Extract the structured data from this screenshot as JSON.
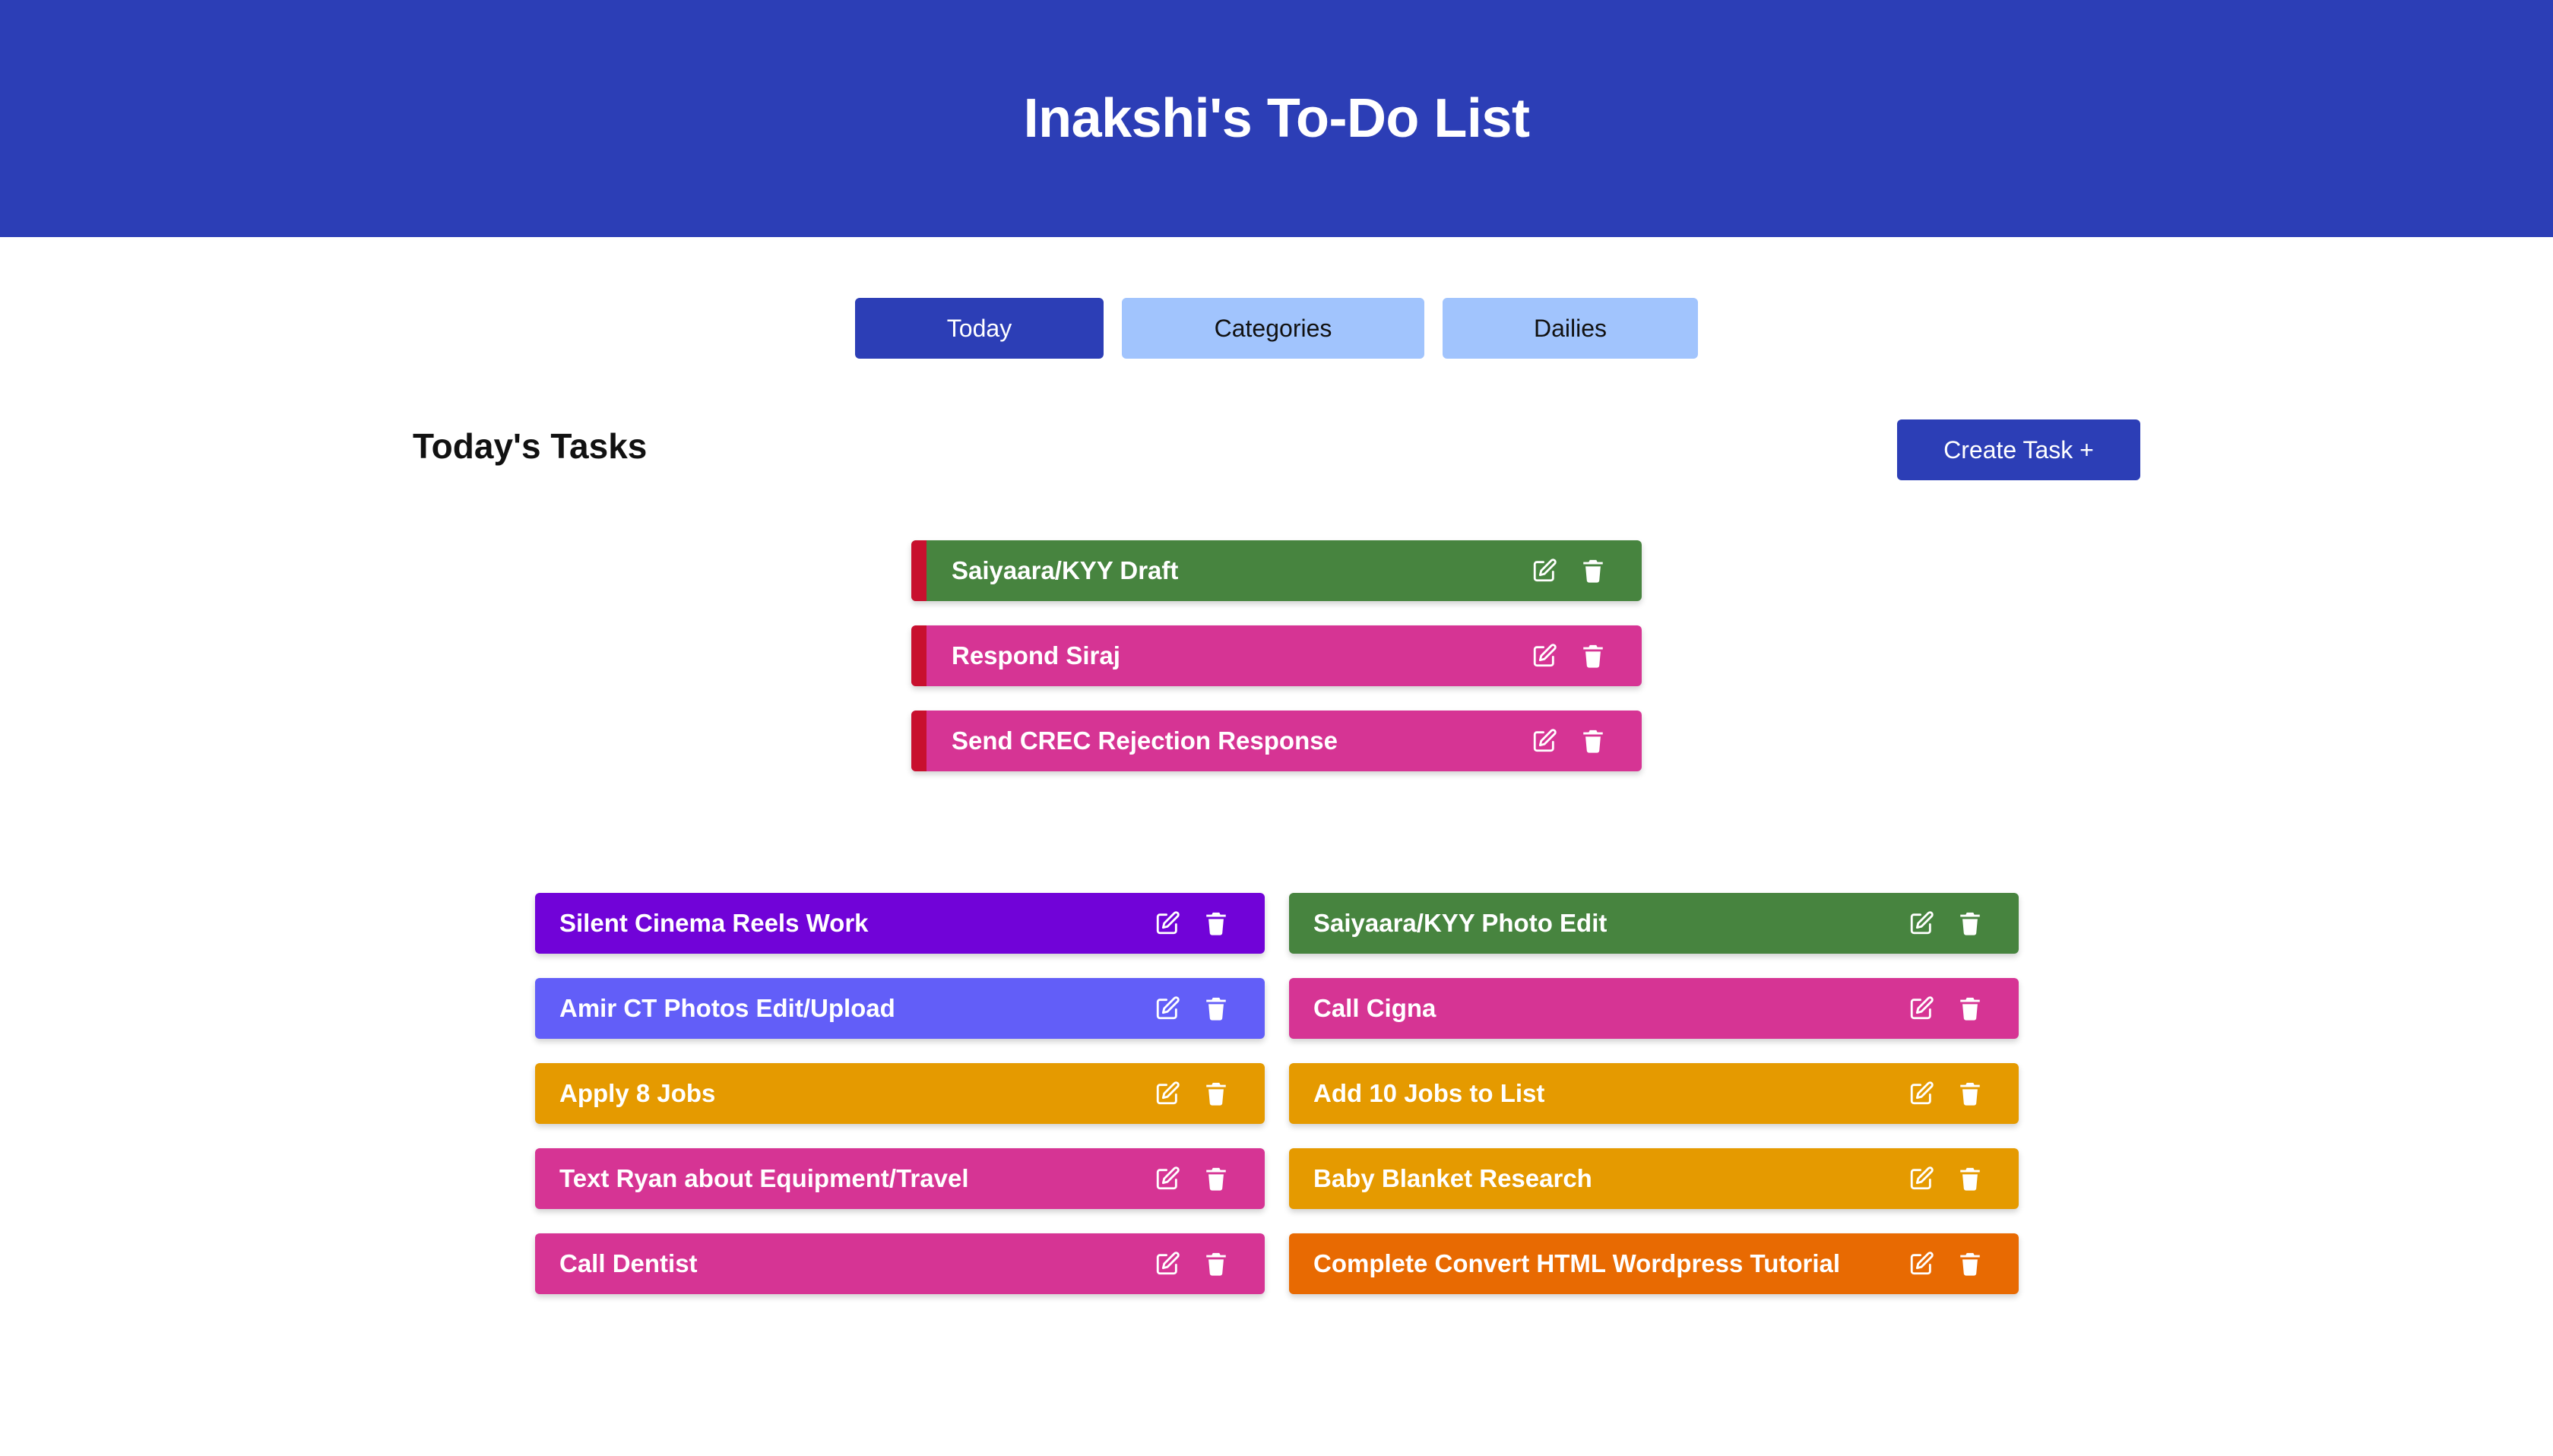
{
  "header": {
    "title": "Inakshi's To-Do List"
  },
  "tabs": [
    {
      "label": "Today",
      "active": true
    },
    {
      "label": "Categories",
      "active": false
    },
    {
      "label": "Dailies",
      "active": false
    }
  ],
  "main": {
    "section_title": "Today's Tasks",
    "create_button": "Create Task +"
  },
  "priority_tasks": [
    {
      "title": "Saiyaara/KYY Draft",
      "color": "#47843f"
    },
    {
      "title": "Respond Siraj",
      "color": "#d63494"
    },
    {
      "title": "Send CREC Rejection Response",
      "color": "#d63494"
    }
  ],
  "task_grid": [
    {
      "title": "Silent Cinema Reels Work",
      "color": "#7103d8"
    },
    {
      "title": "Saiyaara/KYY Photo Edit",
      "color": "#47843f"
    },
    {
      "title": "Amir CT Photos Edit/Upload",
      "color": "#625ef8"
    },
    {
      "title": "Call Cigna",
      "color": "#d63494"
    },
    {
      "title": "Apply 8 Jobs",
      "color": "#e59a00"
    },
    {
      "title": "Add 10 Jobs to List",
      "color": "#e59a00"
    },
    {
      "title": "Text Ryan about Equipment/Travel",
      "color": "#d63494"
    },
    {
      "title": "Baby Blanket Research",
      "color": "#e59a00"
    },
    {
      "title": "Call Dentist",
      "color": "#d63494"
    },
    {
      "title": "Complete Convert HTML Wordpress Tutorial",
      "color": "#e86a02"
    }
  ],
  "icons": {
    "edit": "edit-icon",
    "delete": "trash-icon"
  },
  "colors": {
    "primary": "#2c3eb6",
    "tab_inactive": "#a1c4fd",
    "priority_marker": "#c8102e"
  }
}
